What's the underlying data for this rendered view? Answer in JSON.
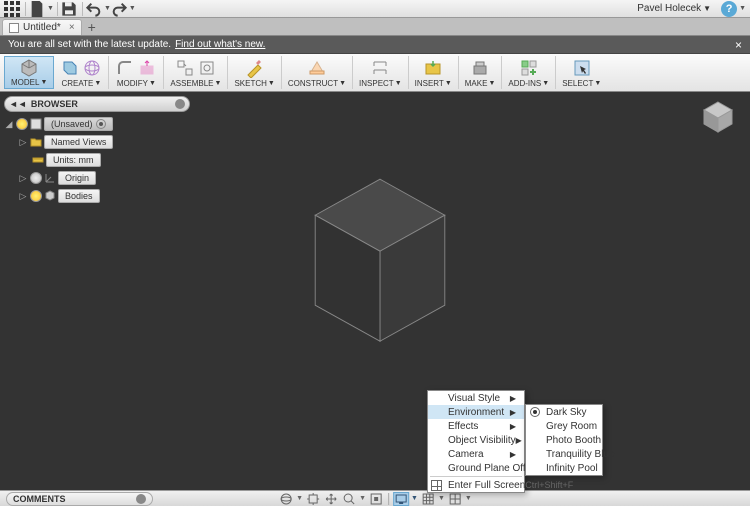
{
  "qa": {
    "user": "Pavel Holecek"
  },
  "tabs": {
    "active": "Untitled*"
  },
  "banner": {
    "text": "You are all set with the latest update.",
    "link": "Find out what's new."
  },
  "ribbon": {
    "model": "MODEL",
    "create": "CREATE",
    "modify": "MODIFY",
    "assemble": "ASSEMBLE",
    "sketch": "SKETCH",
    "construct": "CONSTRUCT",
    "inspect": "INSPECT",
    "insert": "INSERT",
    "make": "MAKE",
    "addins": "ADD-INS",
    "select": "SELECT"
  },
  "browser": {
    "title": "BROWSER",
    "root": "(Unsaved)",
    "items": {
      "named_views": "Named Views",
      "units": "Units: mm",
      "origin": "Origin",
      "bodies": "Bodies"
    }
  },
  "context_menu": {
    "visual_style": "Visual Style",
    "environment": "Environment",
    "effects": "Effects",
    "object_visibility": "Object Visibility",
    "camera": "Camera",
    "ground_plane_offset": "Ground Plane Offset",
    "enter_full_screen": "Enter Full Screen",
    "full_screen_shortcut": "Ctrl+Shift+F"
  },
  "env_submenu": {
    "dark_sky": "Dark Sky",
    "grey_room": "Grey Room",
    "photo_booth": "Photo Booth",
    "tranquility_blue": "Tranquility Blue",
    "infinity_pool": "Infinity Pool"
  },
  "comments": {
    "title": "COMMENTS"
  }
}
